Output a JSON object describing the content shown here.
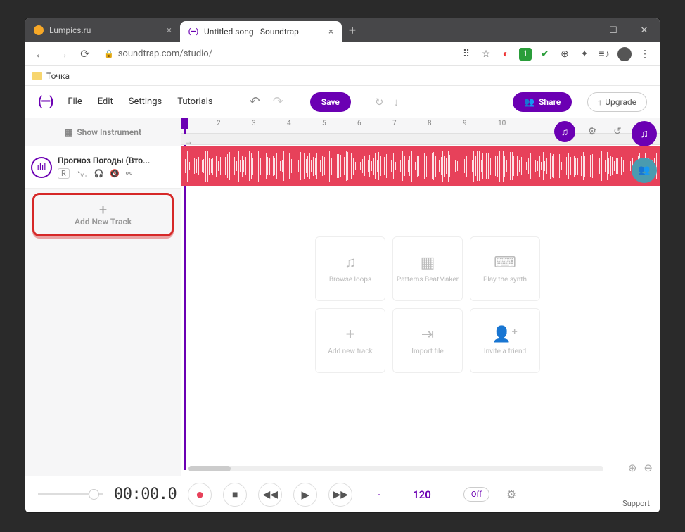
{
  "browser": {
    "tabs": [
      {
        "title": "Lumpics.ru"
      },
      {
        "title": "Untitled song - Soundtrap",
        "icon": "(—)"
      }
    ],
    "url": "soundtrap.com/studio/",
    "bookmark": "Точка"
  },
  "app": {
    "menu": {
      "file": "File",
      "edit": "Edit",
      "settings": "Settings",
      "tutorials": "Tutorials"
    },
    "save": "Save",
    "share": "Share",
    "upgrade": "Upgrade",
    "showInstrument": "Show Instrument",
    "track": {
      "name": "Прогноз Погоды (Вто..."
    },
    "addNewTrack": "Add New Track",
    "ruler": [
      "2",
      "3",
      "4",
      "5",
      "6",
      "7",
      "8",
      "9",
      "10"
    ],
    "cards": [
      {
        "icon": "♫",
        "label": "Browse loops"
      },
      {
        "icon": "▦",
        "label": "Patterns BeatMaker"
      },
      {
        "icon": "⌨",
        "label": "Play the synth"
      },
      {
        "icon": "+",
        "label": "Add new track"
      },
      {
        "icon": "⇥",
        "label": "Import file"
      },
      {
        "icon": "👤⁺",
        "label": "Invite a friend"
      }
    ],
    "transport": {
      "time": "00:00.0",
      "dash": "-",
      "bpm": "120",
      "loop": "Off"
    },
    "support": "Support"
  }
}
